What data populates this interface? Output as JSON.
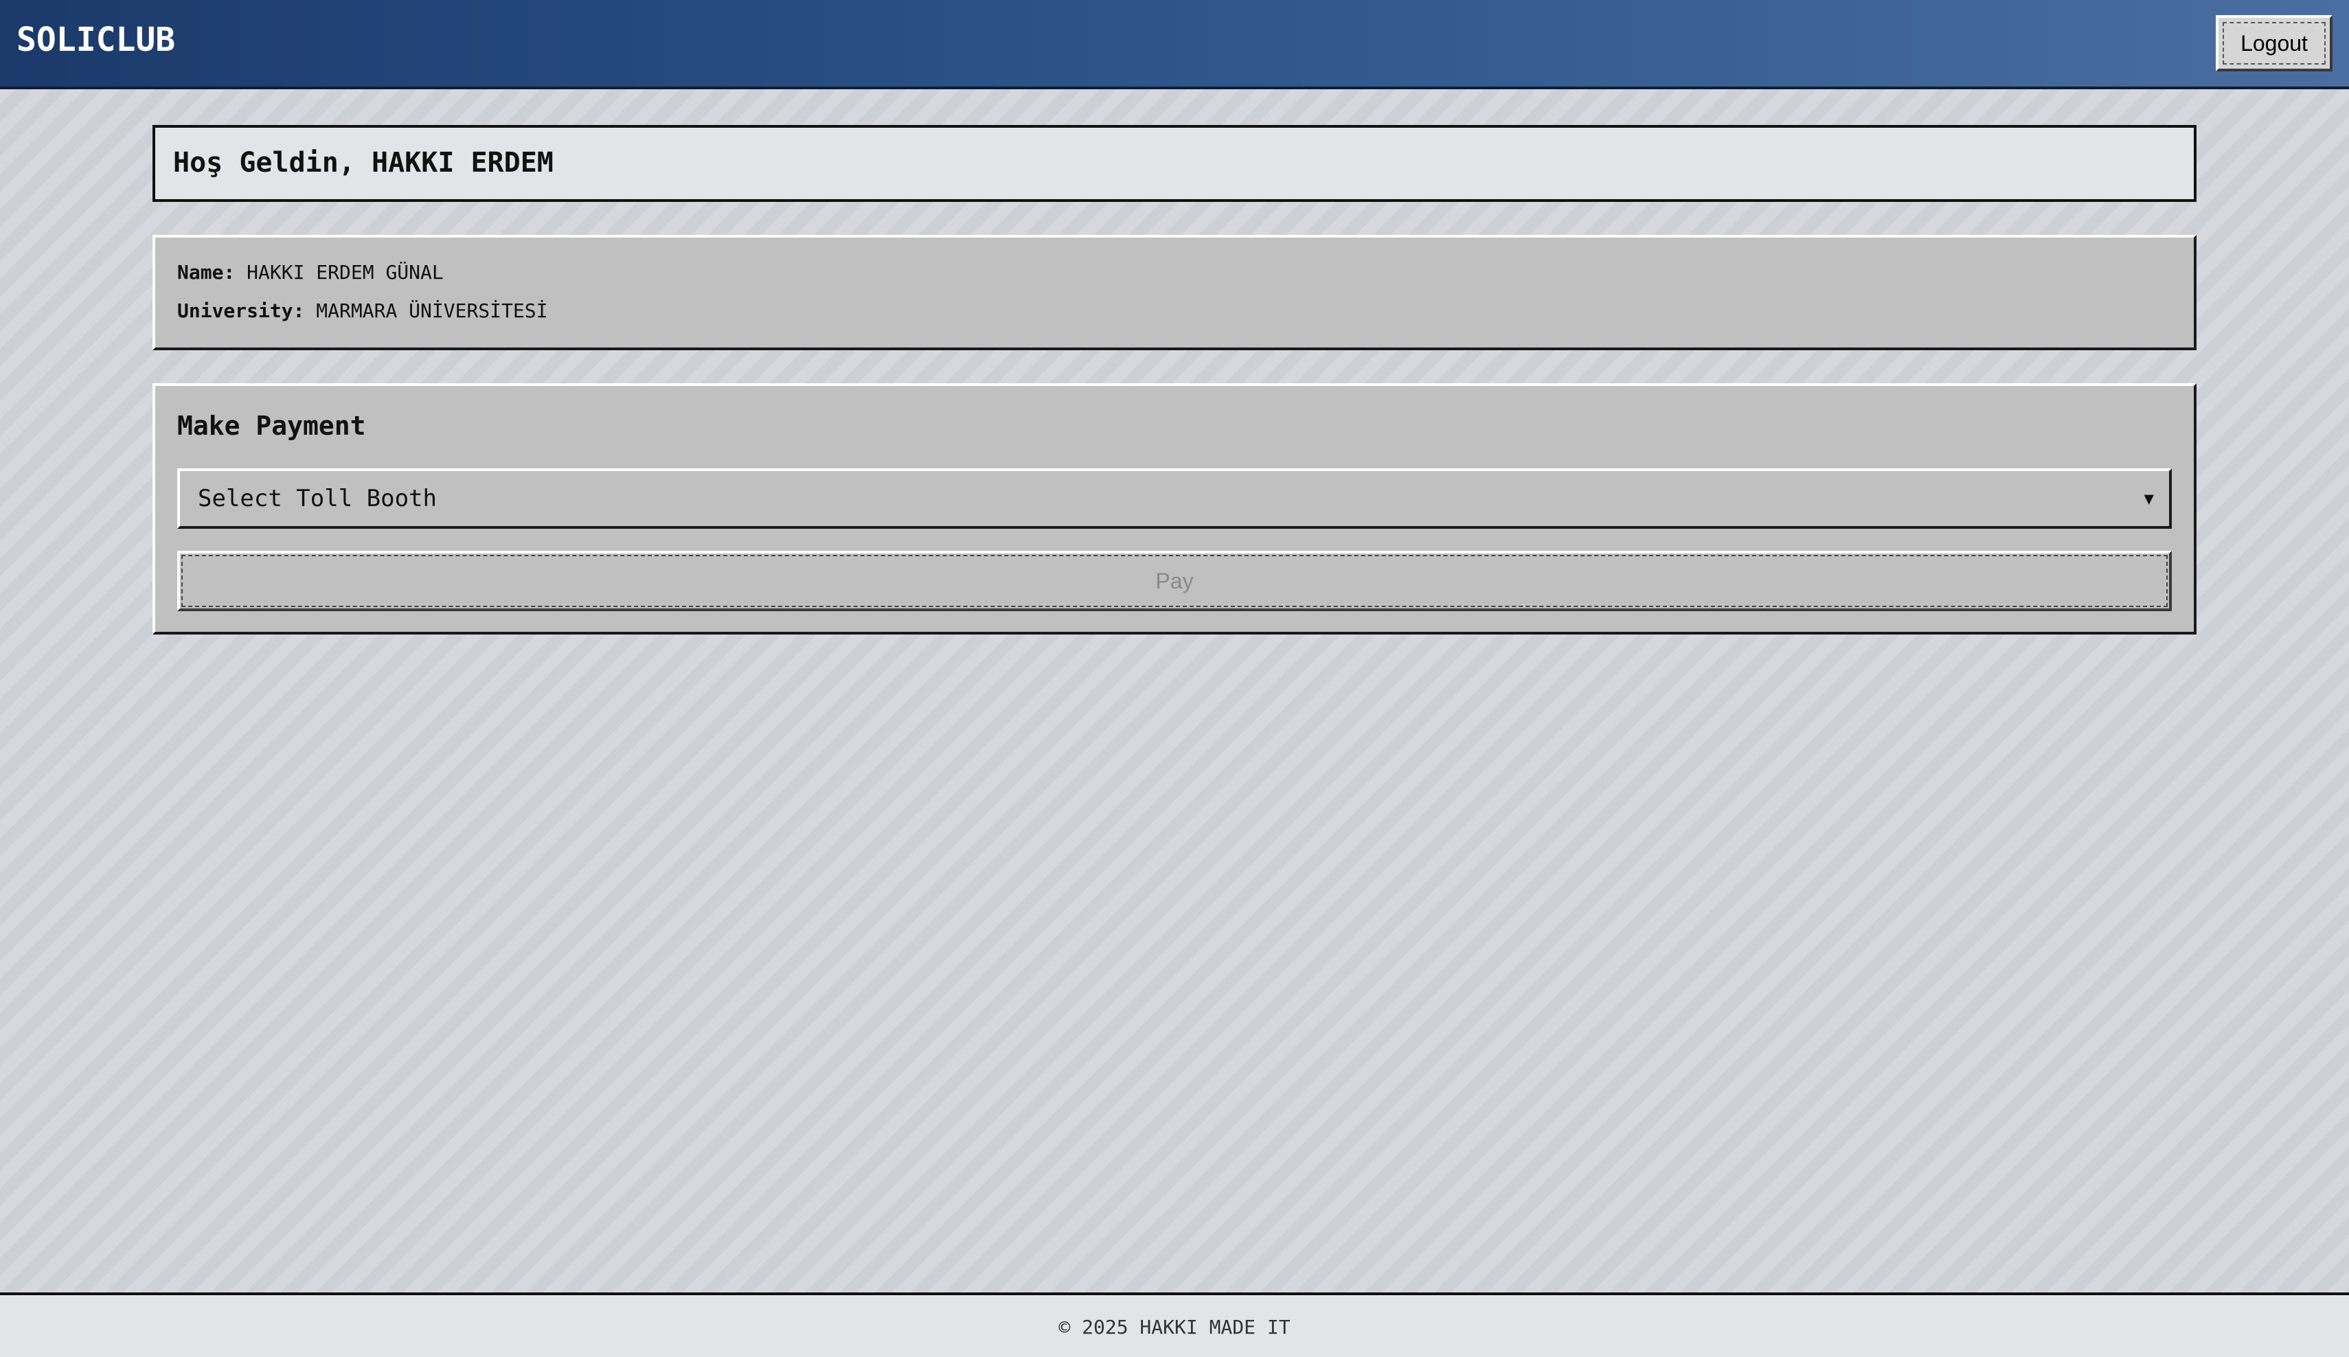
{
  "header": {
    "brand": "SOLICLUB",
    "logout_label": "Logout"
  },
  "welcome": {
    "title": "Hoş Geldin, HAKKI ERDEM"
  },
  "profile": {
    "name_label": "Name:",
    "name_value": "HAKKI ERDEM GÜNAL",
    "university_label": "University:",
    "university_value": "MARMARA ÜNİVERSİTESİ"
  },
  "payment": {
    "title": "Make Payment",
    "select_placeholder": "Select Toll Booth",
    "select_arrow": "▼",
    "pay_label": "Pay",
    "pay_disabled": true
  },
  "footer": {
    "text": "© 2025 HAKKI MADE IT"
  },
  "colors": {
    "header_start": "#1b3a6b",
    "header_end": "#4a6ea1",
    "panel_bg": "#c0c0c0",
    "welcome_bg": "#e3e4e8",
    "page_bg": "#d1d4da"
  },
  "icons": {
    "select_arrow": "chevron-down-icon"
  }
}
